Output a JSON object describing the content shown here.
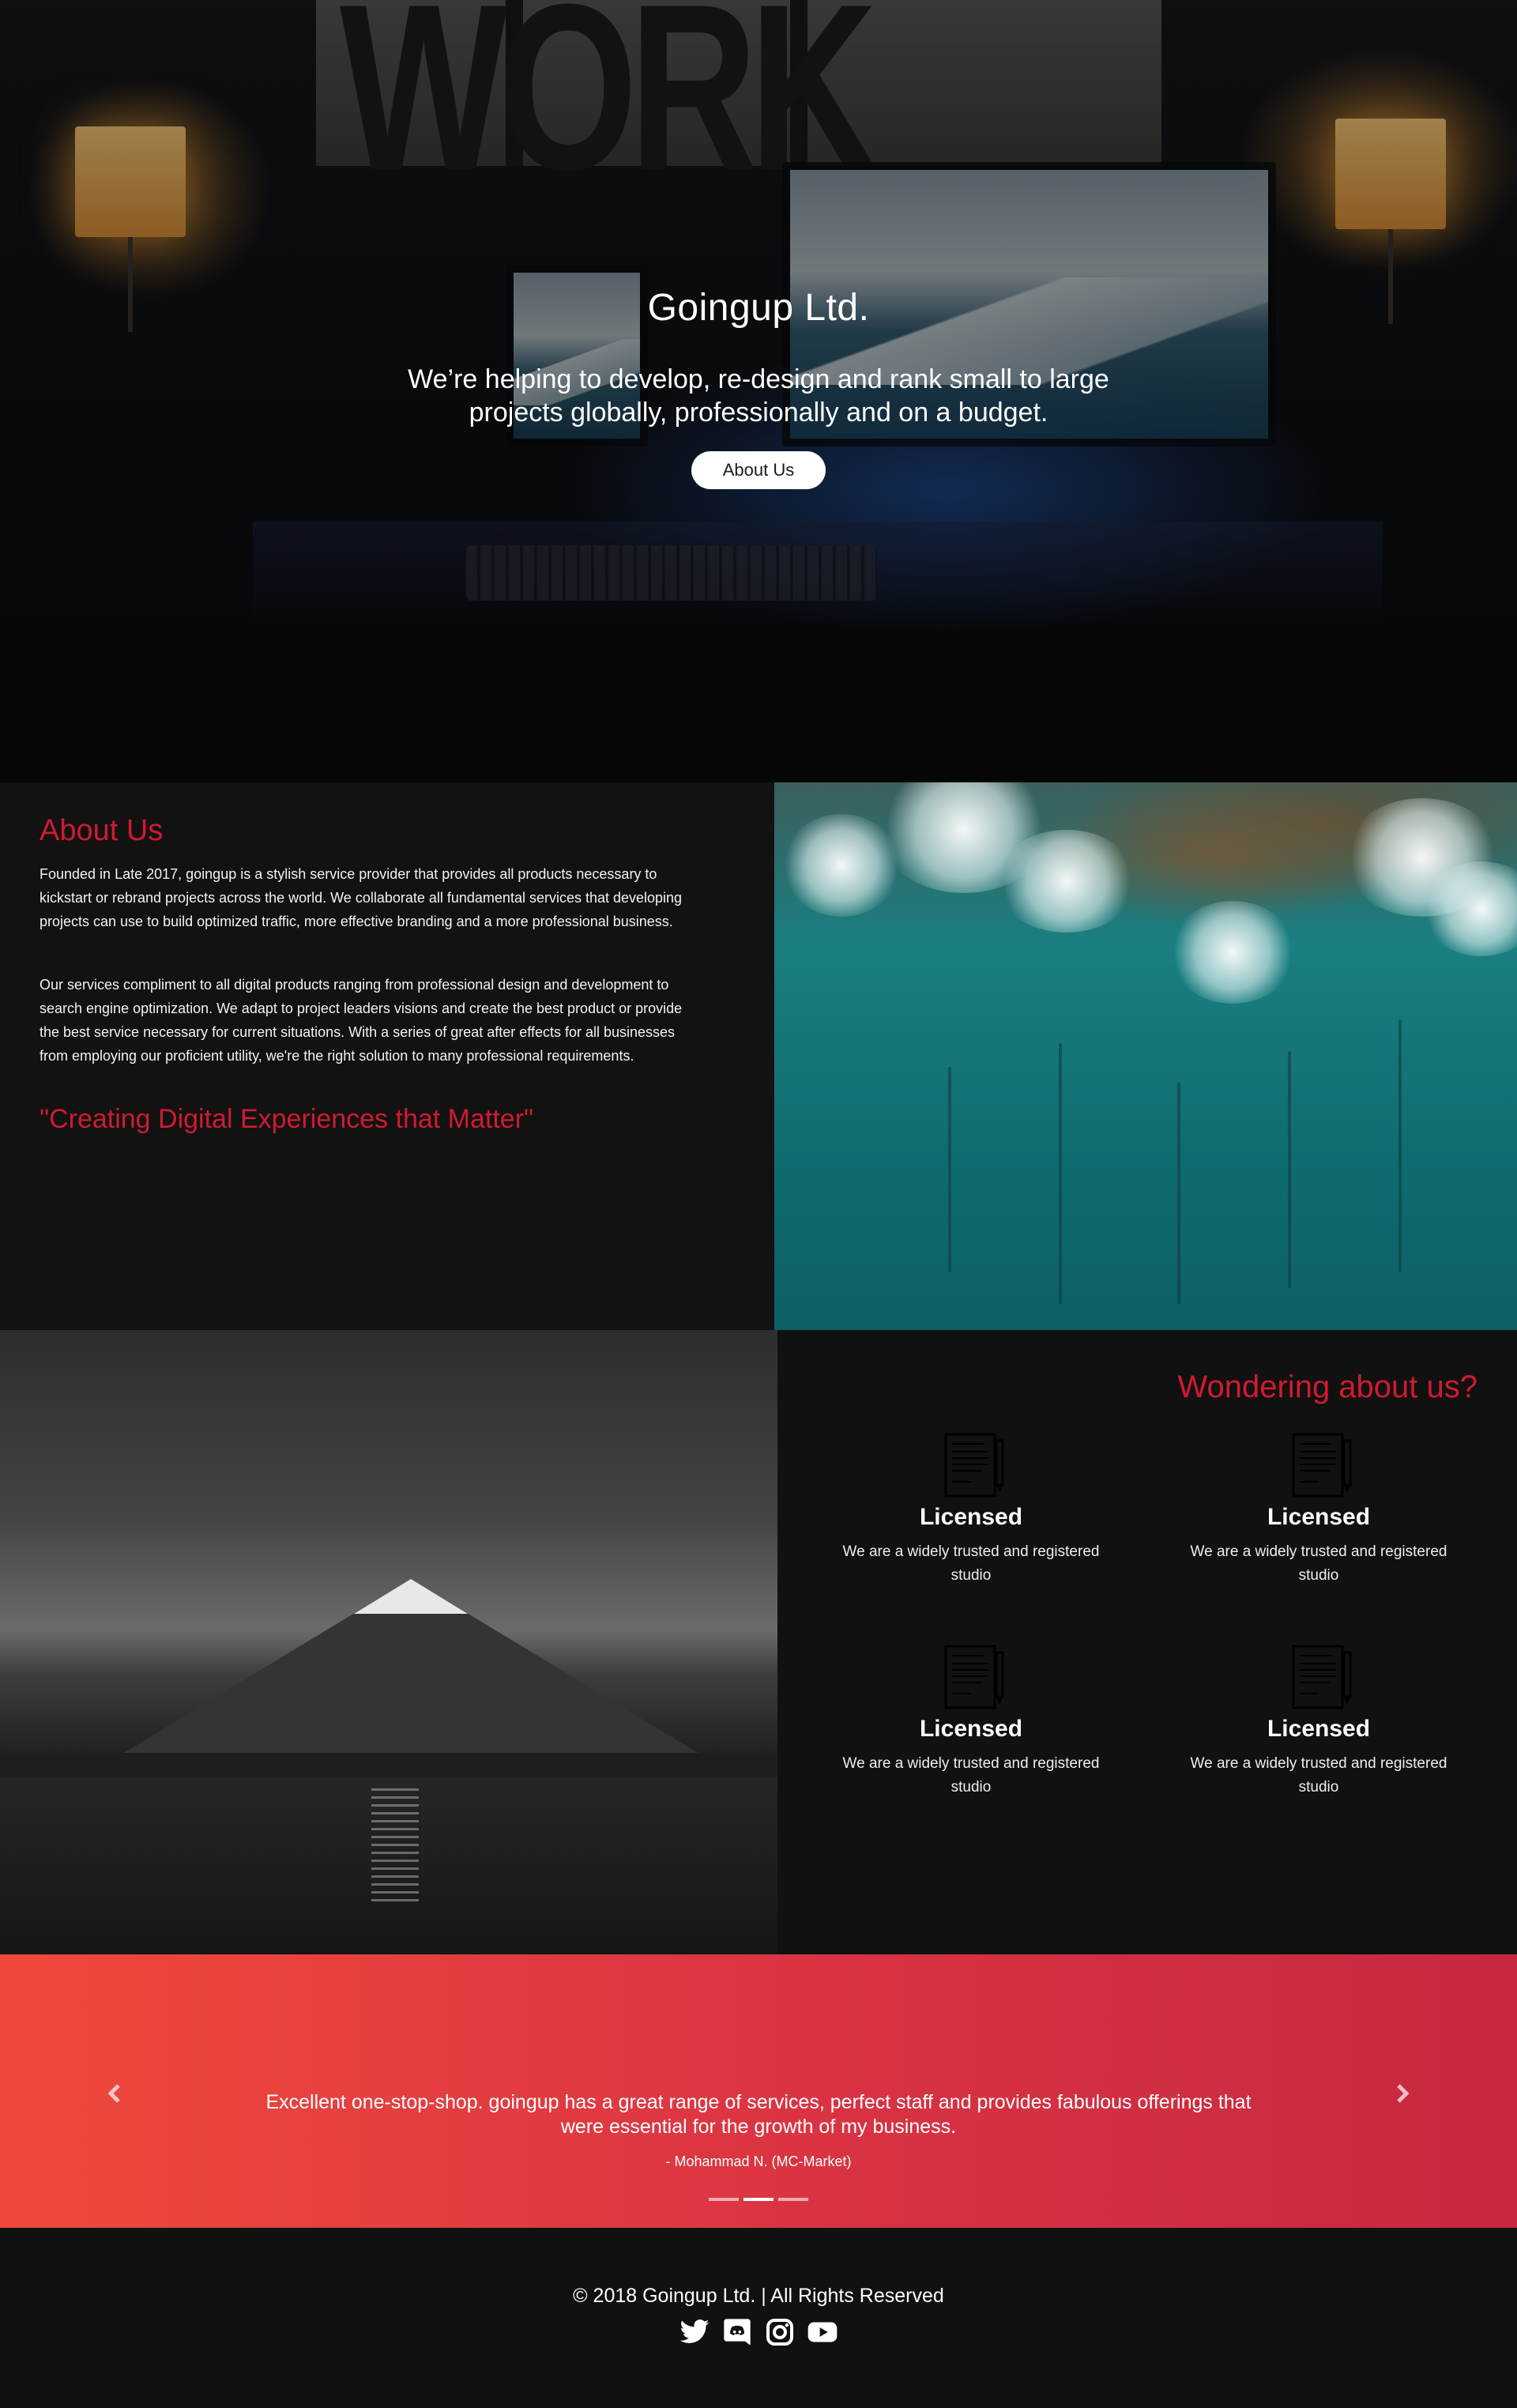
{
  "hero": {
    "background_word": "WORK",
    "title": "Goingup Ltd.",
    "subtitle": "We’re helping to develop, re-design and rank small to large projects globally, professionally and on a budget.",
    "button_label": "About Us"
  },
  "about": {
    "heading": "About Us",
    "paragraphs": [
      "Founded in Late 2017, goingup is a stylish service provider that provides all products necessary to kickstart or rebrand projects across the world. We collaborate all fundamental services that developing projects can use to build optimized traffic, more effective branding and a more professional business.",
      "Our services compliment to all digital products ranging from professional design and development to search engine optimization. We adapt to project leaders visions and create the best product or provide the best service necessary for current situations. With a series of great after effects for all businesses from employing our proficient utility, we're the right solution to many professional requirements."
    ],
    "quote": "\"Creating Digital Experiences that Matter\""
  },
  "wondering": {
    "heading": "Wondering about us?",
    "features": [
      {
        "title": "Licensed",
        "text": "We are a widely trusted and registered studio",
        "icon": "document-icon"
      },
      {
        "title": "Licensed",
        "text": "We are a widely trusted and registered studio",
        "icon": "document-icon"
      },
      {
        "title": "Licensed",
        "text": "We are a widely trusted and registered studio",
        "icon": "document-icon"
      },
      {
        "title": "Licensed",
        "text": "We are a widely trusted and registered studio",
        "icon": "document-icon"
      }
    ]
  },
  "testimonial": {
    "quote": "Excellent one-stop-shop. goingup has a great range of services, perfect staff and provides fabulous offerings that were essential for the growth of my business.",
    "author": "- Mohammad N. (MC-Market)",
    "slide_count": 3,
    "active_slide": 2
  },
  "footer": {
    "copyright": "© 2018 Goingup Ltd. | All Rights Reserved",
    "socials": [
      "twitter-icon",
      "discord-icon",
      "instagram-icon",
      "youtube-icon"
    ]
  },
  "colors": {
    "accent": "#d11a31",
    "background": "#111111",
    "gradient_start": "#f0493c",
    "gradient_end": "#c7283f"
  }
}
